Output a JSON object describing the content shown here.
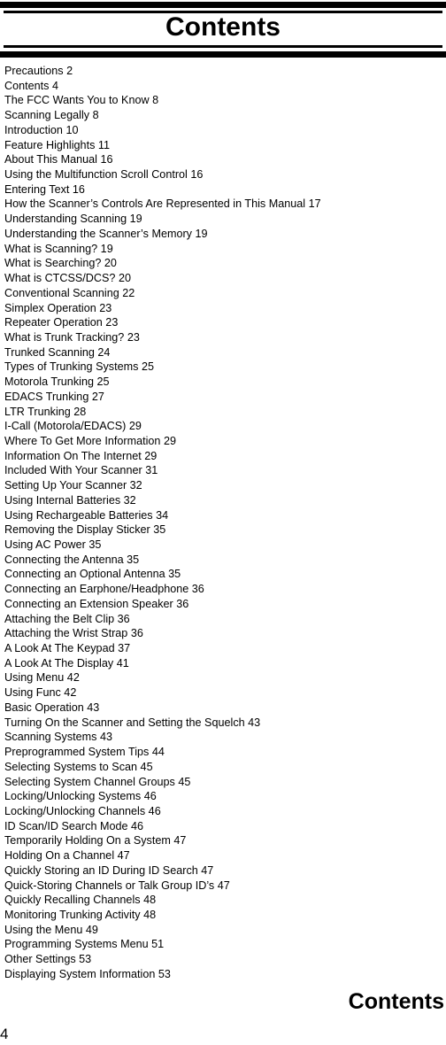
{
  "header": {
    "title": "Contents"
  },
  "toc": {
    "entries": [
      "Precautions 2",
      "Contents 4",
      "The FCC Wants You to Know 8",
      "Scanning Legally 8",
      "Introduction 10",
      "Feature Highlights 11",
      "About This Manual 16",
      "Using the Multifunction Scroll Control 16",
      "Entering Text 16",
      "How the Scanner’s Controls Are Represented in This Manual 17",
      "Understanding Scanning 19",
      "Understanding the Scanner’s Memory 19",
      "What is Scanning? 19",
      "What is Searching? 20",
      "What is CTCSS/DCS? 20",
      "Conventional Scanning 22",
      "Simplex Operation 23",
      "Repeater Operation 23",
      "What is Trunk Tracking? 23",
      "Trunked Scanning 24",
      "Types of Trunking Systems 25",
      "Motorola Trunking 25",
      "EDACS Trunking 27",
      "LTR Trunking 28",
      "I-Call (Motorola/EDACS) 29",
      "Where To Get More Information 29",
      "Information On The Internet 29",
      "Included With Your Scanner 31",
      "Setting Up Your Scanner 32",
      "Using Internal Batteries 32",
      "Using Rechargeable Batteries 34",
      "Removing the Display Sticker 35",
      "Using AC Power 35",
      "Connecting the Antenna 35",
      "Connecting an Optional Antenna 35",
      "Connecting an Earphone/Headphone 36",
      "Connecting an Extension Speaker 36",
      "Attaching the Belt Clip 36",
      "Attaching the Wrist Strap 36",
      "A Look At The Keypad 37",
      "A Look At The Display 41",
      "Using Menu 42",
      "Using Func 42",
      "Basic Operation 43",
      "Turning On the Scanner and Setting the Squelch 43",
      "Scanning Systems 43",
      "Preprogrammed System Tips 44",
      "Selecting Systems to Scan 45",
      "Selecting System Channel Groups 45",
      "Locking/Unlocking Systems 46",
      "Locking/Unlocking Channels 46",
      "ID Scan/ID Search Mode 46",
      "Temporarily Holding On a System 47",
      "Holding On a Channel 47",
      "Quickly Storing an ID During ID Search 47",
      "Quick-Storing Channels or Talk Group ID’s 47",
      "Quickly Recalling Channels 48",
      "Monitoring Trunking Activity 48",
      "Using the Menu 49",
      "Programming Systems Menu 51",
      "Other Settings 53",
      "Displaying System Information 53"
    ]
  },
  "footer": {
    "section": "Contents",
    "page_number": "4"
  }
}
